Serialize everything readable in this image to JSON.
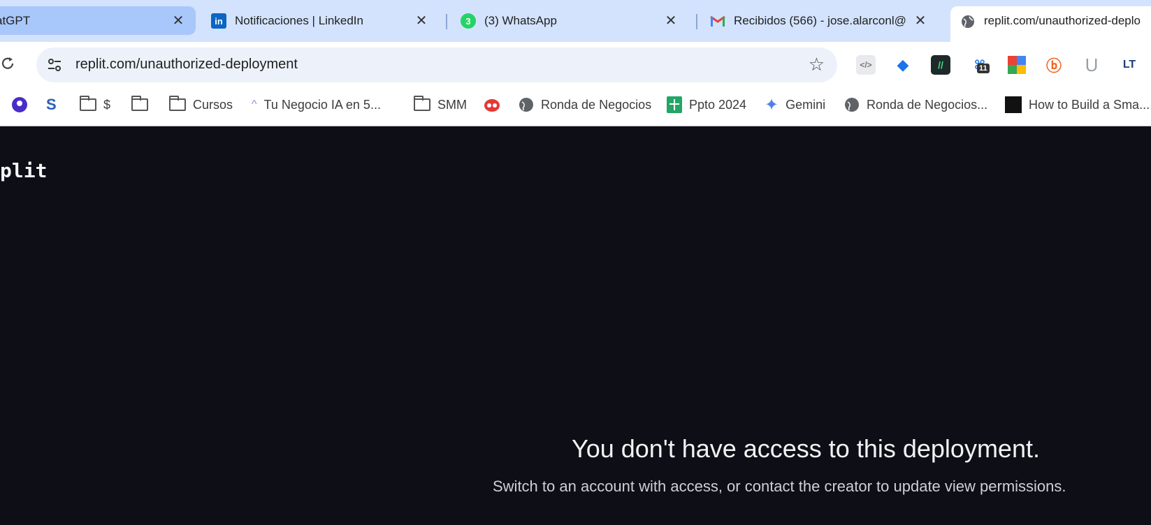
{
  "tabs": [
    {
      "title": "atGPT",
      "close": "✕"
    },
    {
      "title": "Notificaciones | LinkedIn",
      "close": "✕"
    },
    {
      "title": "(3) WhatsApp",
      "close": "✕",
      "badge": "3"
    },
    {
      "title": "Recibidos (566) - jose.alarconl@",
      "close": "✕"
    },
    {
      "title": "replit.com/unauthorized-deplo"
    }
  ],
  "omnibox": {
    "url": "replit.com/unauthorized-deployment"
  },
  "extensions": {
    "badge_count": "11",
    "lt_label": "LT",
    "u_label": "U"
  },
  "bookmarks": [
    {
      "label": "",
      "icon": "location-pin-icon"
    },
    {
      "label": "",
      "icon": "s-logo-icon"
    },
    {
      "label": "$",
      "icon": "folder-icon"
    },
    {
      "label": "",
      "icon": "folder-icon"
    },
    {
      "label": "Cursos",
      "icon": "folder-icon"
    },
    {
      "label": "Tu Negocio IA en 5...",
      "icon": "caret-icon"
    },
    {
      "label": "SMM",
      "icon": "folder-icon"
    },
    {
      "label": "",
      "icon": "robot-icon"
    },
    {
      "label": "Ronda de Negocios",
      "icon": "globe-icon"
    },
    {
      "label": "Ppto 2024",
      "icon": "sheets-icon"
    },
    {
      "label": "Gemini",
      "icon": "gemini-sparkle-icon"
    },
    {
      "label": "Ronda de Negocios...",
      "icon": "globe-icon"
    },
    {
      "label": "How to Build a Sma...",
      "icon": "video-thumb-icon"
    }
  ],
  "page": {
    "brand": "plit",
    "title": "You don't have access to this deployment.",
    "subtitle": "Switch to an account with access, or contact the creator to update view permissions."
  },
  "colors": {
    "tabstrip": "#d3e3fd",
    "active_tab": "#ffffff",
    "page_bg": "#0e0e17",
    "linkedin": "#0a66c2",
    "whatsapp": "#25d366"
  }
}
